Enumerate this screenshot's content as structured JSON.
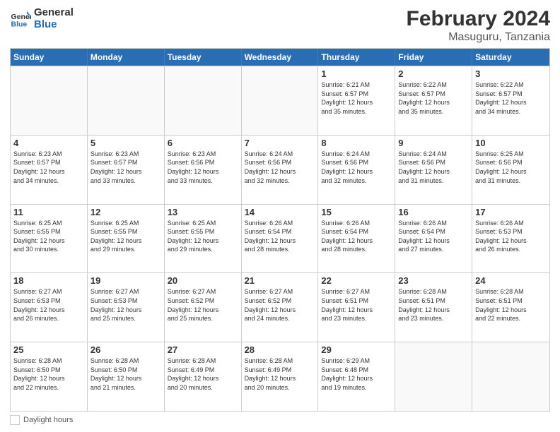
{
  "header": {
    "logo_general": "General",
    "logo_blue": "Blue",
    "main_title": "February 2024",
    "subtitle": "Masuguru, Tanzania"
  },
  "calendar": {
    "days_of_week": [
      "Sunday",
      "Monday",
      "Tuesday",
      "Wednesday",
      "Thursday",
      "Friday",
      "Saturday"
    ],
    "weeks": [
      [
        {
          "day": "",
          "info": ""
        },
        {
          "day": "",
          "info": ""
        },
        {
          "day": "",
          "info": ""
        },
        {
          "day": "",
          "info": ""
        },
        {
          "day": "1",
          "info": "Sunrise: 6:21 AM\nSunset: 6:57 PM\nDaylight: 12 hours\nand 35 minutes."
        },
        {
          "day": "2",
          "info": "Sunrise: 6:22 AM\nSunset: 6:57 PM\nDaylight: 12 hours\nand 35 minutes."
        },
        {
          "day": "3",
          "info": "Sunrise: 6:22 AM\nSunset: 6:57 PM\nDaylight: 12 hours\nand 34 minutes."
        }
      ],
      [
        {
          "day": "4",
          "info": "Sunrise: 6:23 AM\nSunset: 6:57 PM\nDaylight: 12 hours\nand 34 minutes."
        },
        {
          "day": "5",
          "info": "Sunrise: 6:23 AM\nSunset: 6:57 PM\nDaylight: 12 hours\nand 33 minutes."
        },
        {
          "day": "6",
          "info": "Sunrise: 6:23 AM\nSunset: 6:56 PM\nDaylight: 12 hours\nand 33 minutes."
        },
        {
          "day": "7",
          "info": "Sunrise: 6:24 AM\nSunset: 6:56 PM\nDaylight: 12 hours\nand 32 minutes."
        },
        {
          "day": "8",
          "info": "Sunrise: 6:24 AM\nSunset: 6:56 PM\nDaylight: 12 hours\nand 32 minutes."
        },
        {
          "day": "9",
          "info": "Sunrise: 6:24 AM\nSunset: 6:56 PM\nDaylight: 12 hours\nand 31 minutes."
        },
        {
          "day": "10",
          "info": "Sunrise: 6:25 AM\nSunset: 6:56 PM\nDaylight: 12 hours\nand 31 minutes."
        }
      ],
      [
        {
          "day": "11",
          "info": "Sunrise: 6:25 AM\nSunset: 6:55 PM\nDaylight: 12 hours\nand 30 minutes."
        },
        {
          "day": "12",
          "info": "Sunrise: 6:25 AM\nSunset: 6:55 PM\nDaylight: 12 hours\nand 29 minutes."
        },
        {
          "day": "13",
          "info": "Sunrise: 6:25 AM\nSunset: 6:55 PM\nDaylight: 12 hours\nand 29 minutes."
        },
        {
          "day": "14",
          "info": "Sunrise: 6:26 AM\nSunset: 6:54 PM\nDaylight: 12 hours\nand 28 minutes."
        },
        {
          "day": "15",
          "info": "Sunrise: 6:26 AM\nSunset: 6:54 PM\nDaylight: 12 hours\nand 28 minutes."
        },
        {
          "day": "16",
          "info": "Sunrise: 6:26 AM\nSunset: 6:54 PM\nDaylight: 12 hours\nand 27 minutes."
        },
        {
          "day": "17",
          "info": "Sunrise: 6:26 AM\nSunset: 6:53 PM\nDaylight: 12 hours\nand 26 minutes."
        }
      ],
      [
        {
          "day": "18",
          "info": "Sunrise: 6:27 AM\nSunset: 6:53 PM\nDaylight: 12 hours\nand 26 minutes."
        },
        {
          "day": "19",
          "info": "Sunrise: 6:27 AM\nSunset: 6:53 PM\nDaylight: 12 hours\nand 25 minutes."
        },
        {
          "day": "20",
          "info": "Sunrise: 6:27 AM\nSunset: 6:52 PM\nDaylight: 12 hours\nand 25 minutes."
        },
        {
          "day": "21",
          "info": "Sunrise: 6:27 AM\nSunset: 6:52 PM\nDaylight: 12 hours\nand 24 minutes."
        },
        {
          "day": "22",
          "info": "Sunrise: 6:27 AM\nSunset: 6:51 PM\nDaylight: 12 hours\nand 23 minutes."
        },
        {
          "day": "23",
          "info": "Sunrise: 6:28 AM\nSunset: 6:51 PM\nDaylight: 12 hours\nand 23 minutes."
        },
        {
          "day": "24",
          "info": "Sunrise: 6:28 AM\nSunset: 6:51 PM\nDaylight: 12 hours\nand 22 minutes."
        }
      ],
      [
        {
          "day": "25",
          "info": "Sunrise: 6:28 AM\nSunset: 6:50 PM\nDaylight: 12 hours\nand 22 minutes."
        },
        {
          "day": "26",
          "info": "Sunrise: 6:28 AM\nSunset: 6:50 PM\nDaylight: 12 hours\nand 21 minutes."
        },
        {
          "day": "27",
          "info": "Sunrise: 6:28 AM\nSunset: 6:49 PM\nDaylight: 12 hours\nand 20 minutes."
        },
        {
          "day": "28",
          "info": "Sunrise: 6:28 AM\nSunset: 6:49 PM\nDaylight: 12 hours\nand 20 minutes."
        },
        {
          "day": "29",
          "info": "Sunrise: 6:29 AM\nSunset: 6:48 PM\nDaylight: 12 hours\nand 19 minutes."
        },
        {
          "day": "",
          "info": ""
        },
        {
          "day": "",
          "info": ""
        }
      ]
    ]
  },
  "footer": {
    "daylight_label": "Daylight hours"
  }
}
